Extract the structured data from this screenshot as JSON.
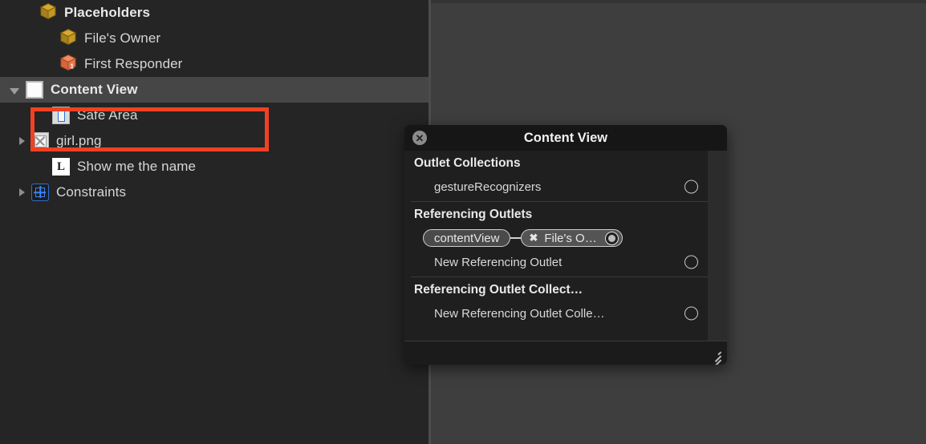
{
  "outline": {
    "rows": [
      {
        "label": "Placeholders",
        "icon": "yellow-cube-icon",
        "bold": true,
        "twisty": "none",
        "indent": 34,
        "selected": false
      },
      {
        "label": "File's Owner",
        "icon": "yellow-cube-icon",
        "bold": false,
        "twisty": "none",
        "indent": 59,
        "selected": false
      },
      {
        "label": "First Responder",
        "icon": "orange-cube-icon",
        "bold": false,
        "twisty": "none",
        "indent": 59,
        "selected": false
      },
      {
        "label": "Content View",
        "icon": "view-square-icon",
        "bold": true,
        "twisty": "open",
        "indent": 12,
        "selected": true
      },
      {
        "label": "Safe Area",
        "icon": "safe-area-icon",
        "bold": false,
        "twisty": "none",
        "indent": 50,
        "selected": false
      },
      {
        "label": "girl.png",
        "icon": "image-icon",
        "bold": false,
        "twisty": "closed",
        "indent": 24,
        "selected": false
      },
      {
        "label": "Show me the name",
        "icon": "label-l-icon",
        "bold": false,
        "twisty": "none",
        "indent": 50,
        "selected": false
      },
      {
        "label": "Constraints",
        "icon": "constraints-icon",
        "bold": false,
        "twisty": "closed",
        "indent": 24,
        "selected": false
      }
    ]
  },
  "annotation": {
    "color": "#f04124",
    "target": "Content View"
  },
  "popover": {
    "title": "Content View",
    "close_glyph": "✕",
    "sections": [
      {
        "heading": "Outlet Collections",
        "rows": [
          {
            "name": "gestureRecognizers",
            "connected": false
          }
        ]
      },
      {
        "heading": "Referencing Outlets",
        "rows": [
          {
            "name": "contentView",
            "connected": true,
            "target": "File's O…",
            "unlink_glyph": "✖"
          },
          {
            "name": "New Referencing Outlet",
            "connected": false
          }
        ]
      },
      {
        "heading": "Referencing Outlet Collect…",
        "rows": [
          {
            "name": "New Referencing Outlet Colle…",
            "connected": false
          }
        ]
      }
    ]
  }
}
